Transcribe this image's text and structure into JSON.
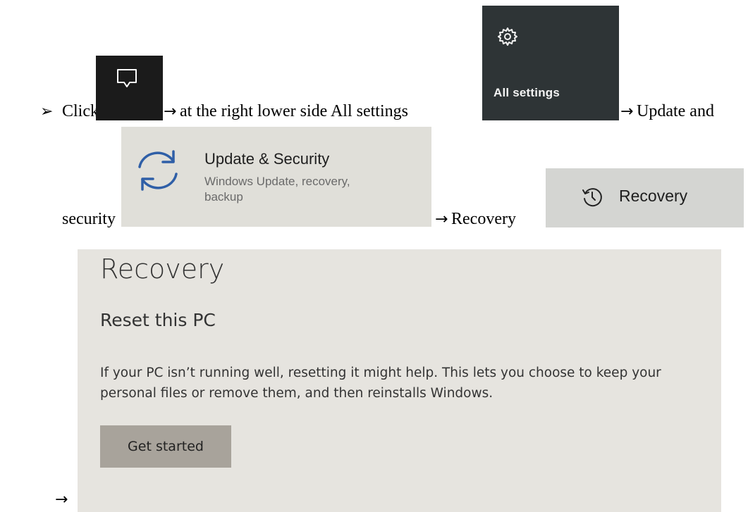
{
  "instructions": {
    "bullet": "➢",
    "arrow": "→",
    "line1": {
      "click": "Click",
      "lower_side": "at the right lower side All settings",
      "update_and": "Update and"
    },
    "line2": {
      "security": "security",
      "recovery": "Recovery"
    }
  },
  "tiles": {
    "action_center": {
      "icon": "action-center-icon"
    },
    "all_settings": {
      "icon": "gear-icon",
      "label": "All settings"
    },
    "update_security": {
      "icon": "sync-icon",
      "title": "Update & Security",
      "subtitle": "Windows Update, recovery,\nbackup"
    },
    "recovery_menu": {
      "icon": "history-icon",
      "label": "Recovery"
    }
  },
  "recovery_page": {
    "title": "Recovery",
    "section_heading": "Reset this PC",
    "description": "If your PC isn’t running well, resetting it might help. This lets you choose to keep your personal files or remove them, and then reinstalls Windows.",
    "button_label": "Get started"
  },
  "colors": {
    "tile_dark": "#1b1b1b",
    "settings_tile": "#2e3436",
    "sync_blue": "#2f5fa7",
    "get_started_button": "#a8a39b"
  }
}
